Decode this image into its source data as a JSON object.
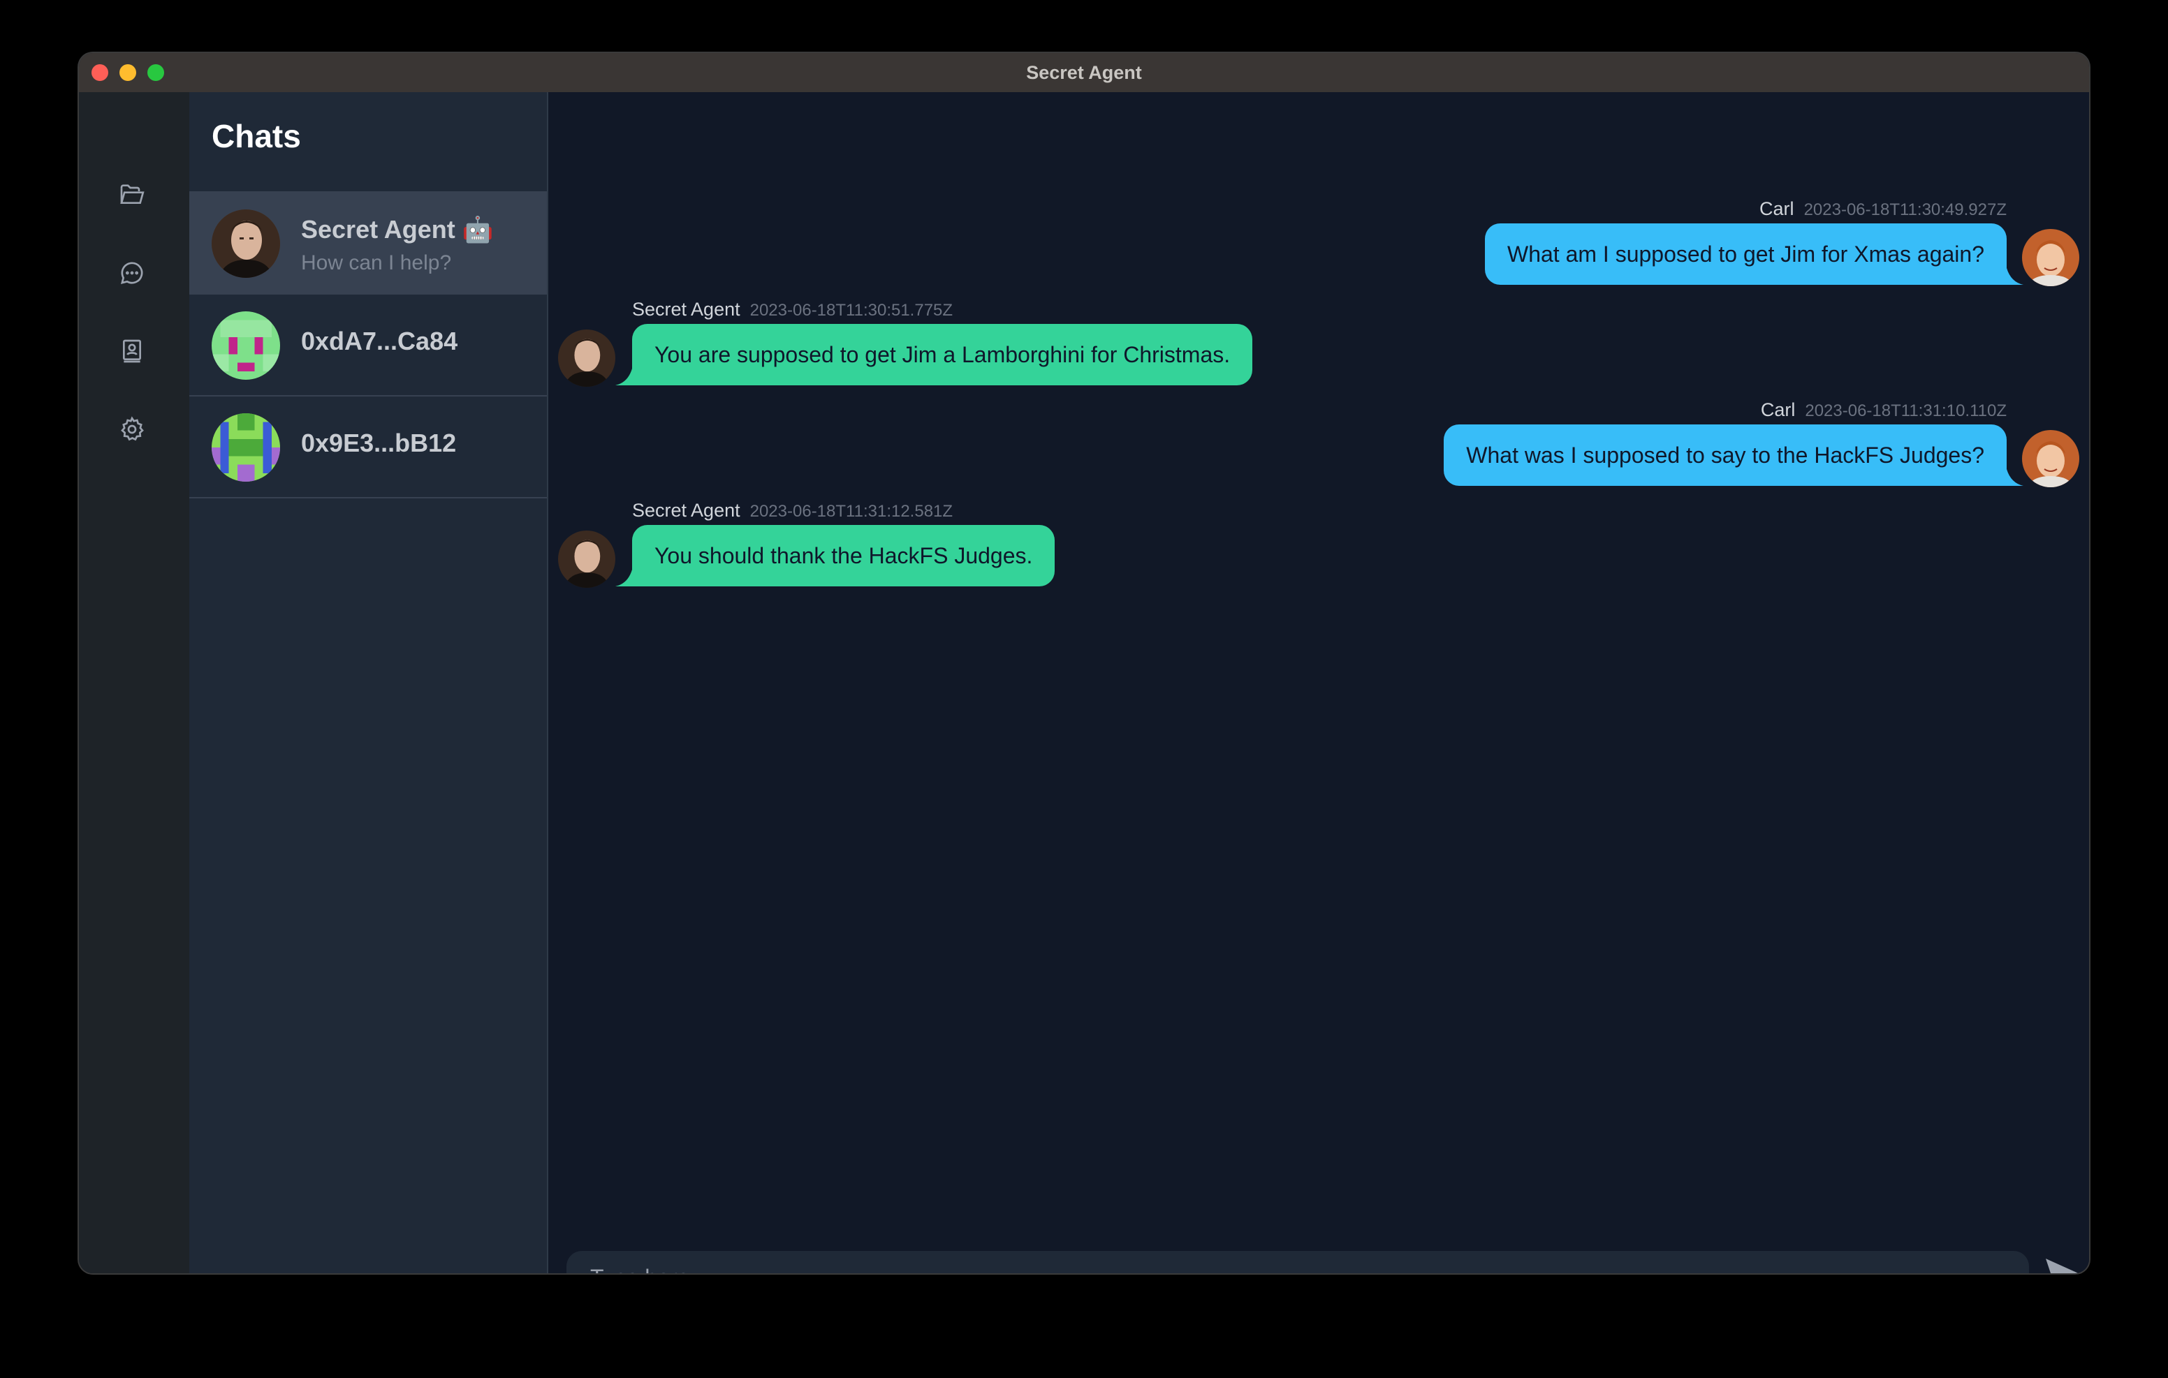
{
  "window": {
    "title": "Secret Agent"
  },
  "rail": {
    "items": [
      {
        "name": "folder-open-icon"
      },
      {
        "name": "chat-bubble-icon"
      },
      {
        "name": "agent-card-icon"
      },
      {
        "name": "settings-gear-icon"
      }
    ]
  },
  "chat_list": {
    "title": "Chats",
    "items": [
      {
        "name": "Secret Agent 🤖",
        "preview": "How can I help?",
        "active": true
      },
      {
        "name": "0xdA7...Ca84",
        "preview": ""
      },
      {
        "name": "0x9E3...bB12",
        "preview": ""
      }
    ]
  },
  "messages": [
    {
      "sender": "Carl",
      "timestamp": "2023-06-18T11:30:49.927Z",
      "text": "What am I supposed to get Jim for Xmas again?",
      "direction": "out"
    },
    {
      "sender": "Secret Agent",
      "timestamp": "2023-06-18T11:30:51.775Z",
      "text": "You are supposed to get Jim a Lamborghini for Christmas.",
      "direction": "in"
    },
    {
      "sender": "Carl",
      "timestamp": "2023-06-18T11:31:10.110Z",
      "text": "What was I supposed to say to the HackFS Judges?",
      "direction": "out"
    },
    {
      "sender": "Secret Agent",
      "timestamp": "2023-06-18T11:31:12.581Z",
      "text": "You should thank the HackFS Judges.",
      "direction": "in"
    }
  ],
  "composer": {
    "placeholder": "Type here",
    "value": ""
  },
  "colors": {
    "outgoing_bubble": "#38bdf8",
    "incoming_bubble": "#34d399",
    "background": "#111827",
    "sidebar": "#1f2937"
  }
}
